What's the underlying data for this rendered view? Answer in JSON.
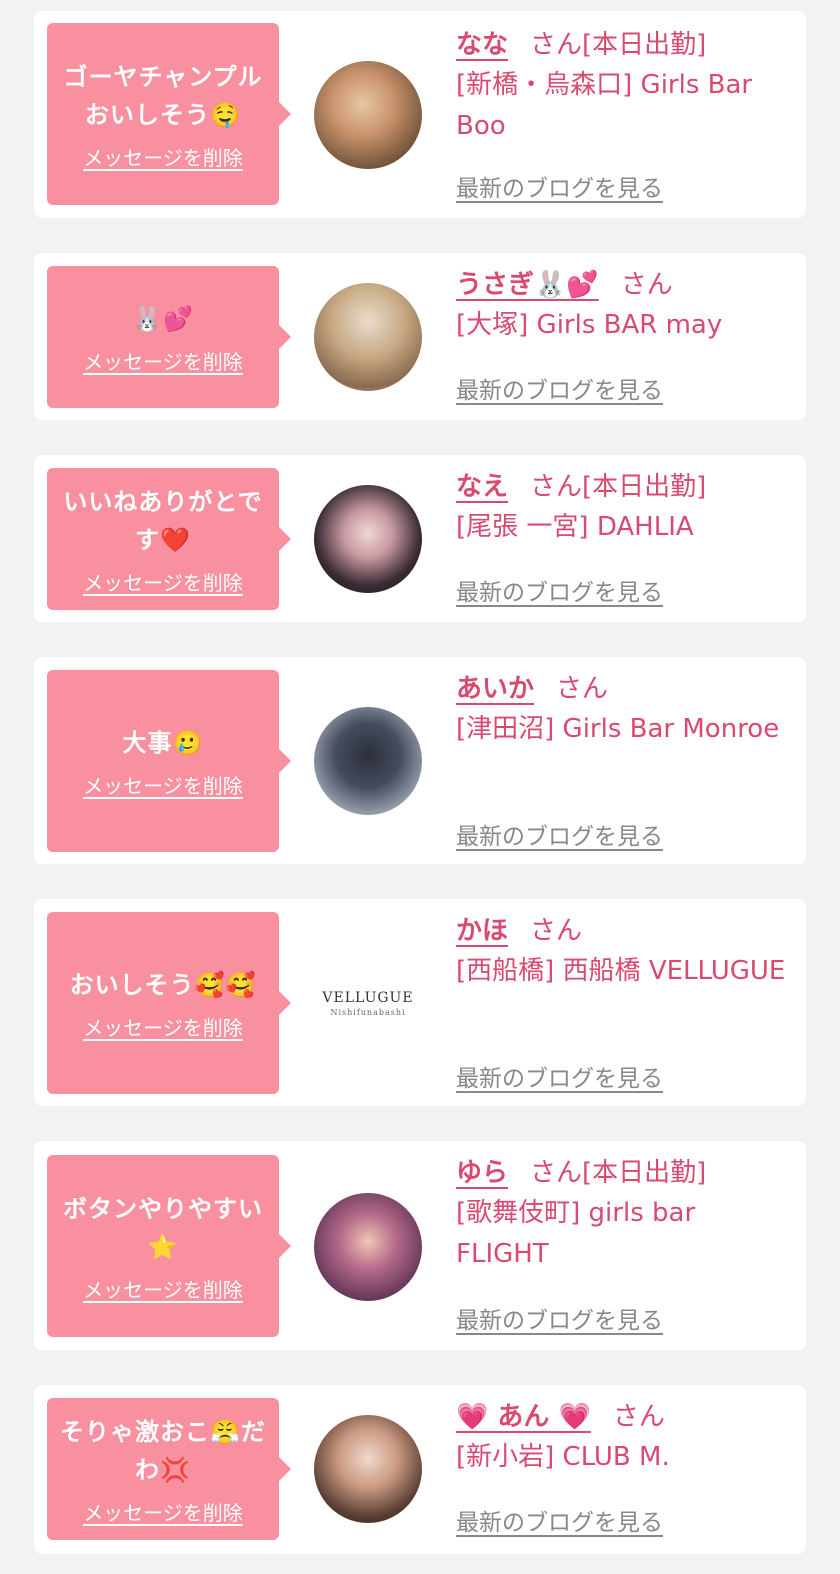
{
  "delete_label": "メッセージを削除",
  "blog_label": "最新のブログを見る",
  "colors": {
    "background": "#f2f2f2",
    "bubble": "#f9909f",
    "name": "#d84a6e",
    "link_gray": "#888888"
  },
  "items": [
    {
      "message": "ゴーヤチャンプル おいしそう🤤",
      "name": "なな",
      "suffix": "さん[本日出勤]",
      "shop": "[新橋・烏森口] Girls Bar Boo"
    },
    {
      "message": "🐰💕",
      "name": "うさぎ🐰💕",
      "suffix": "さん",
      "shop": "[大塚] Girls BAR may"
    },
    {
      "message": "いいねありがとです❤️",
      "name": "なえ",
      "suffix": "さん[本日出勤]",
      "shop": "[尾張 一宮] DAHLIA"
    },
    {
      "message": "大事🥲",
      "name": "あいか",
      "suffix": "さん",
      "shop": "[津田沼] Girls Bar Monroe"
    },
    {
      "message": "おいしそう🥰🥰",
      "name": "かほ",
      "suffix": "さん",
      "shop": "[西船橋] 西船橋 VELLUGUE",
      "logo_main": "VELLUGUE",
      "logo_sub": "Nishifunabashi"
    },
    {
      "message": "ボタンやりやすい ⭐",
      "name": "ゆら",
      "suffix": "さん[本日出勤]",
      "shop": "[歌舞伎町] girls bar FLIGHT"
    },
    {
      "message": "そりゃ激おこ😤だわ💢",
      "name": "💗 あん 💗",
      "suffix": "さん",
      "shop": "[新小岩] CLUB M."
    }
  ]
}
